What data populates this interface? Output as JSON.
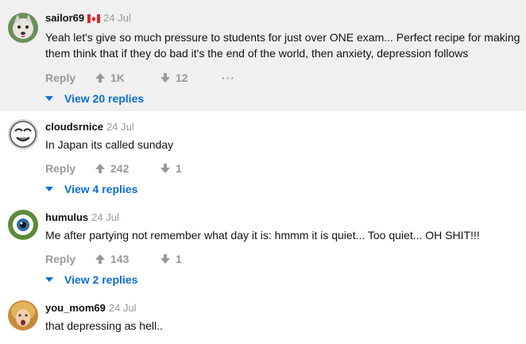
{
  "comments": [
    {
      "username": "sailor69",
      "flag_icon": "canada-flag-icon",
      "date": "24 Jul",
      "text": "Yeah let's give so much pressure to students for just over ONE exam... Perfect recipe for making them think that if they do bad it's the end of the world, then anxiety, depression follows",
      "reply_label": "Reply",
      "upvotes": "1K",
      "downvotes": "12",
      "more_label": "···",
      "view_replies": "View 20 replies",
      "highlighted": true
    },
    {
      "username": "cloudsrnice",
      "date": "24 Jul",
      "text": "In Japan its called sunday",
      "reply_label": "Reply",
      "upvotes": "242",
      "downvotes": "1",
      "view_replies": "View 4 replies"
    },
    {
      "username": "humulus",
      "date": "24 Jul",
      "text": "Me after partying not remember what day it is: hmmm it is quiet... Too quiet... OH SHIT!!!",
      "reply_label": "Reply",
      "upvotes": "143",
      "downvotes": "1",
      "view_replies": "View 2 replies"
    },
    {
      "username": "you_mom69",
      "date": "24 Jul",
      "text": "that depressing as hell.."
    }
  ],
  "colors": {
    "highlight_bg": "#f0f0f0",
    "link": "#0a6ed1",
    "muted": "#999999"
  }
}
